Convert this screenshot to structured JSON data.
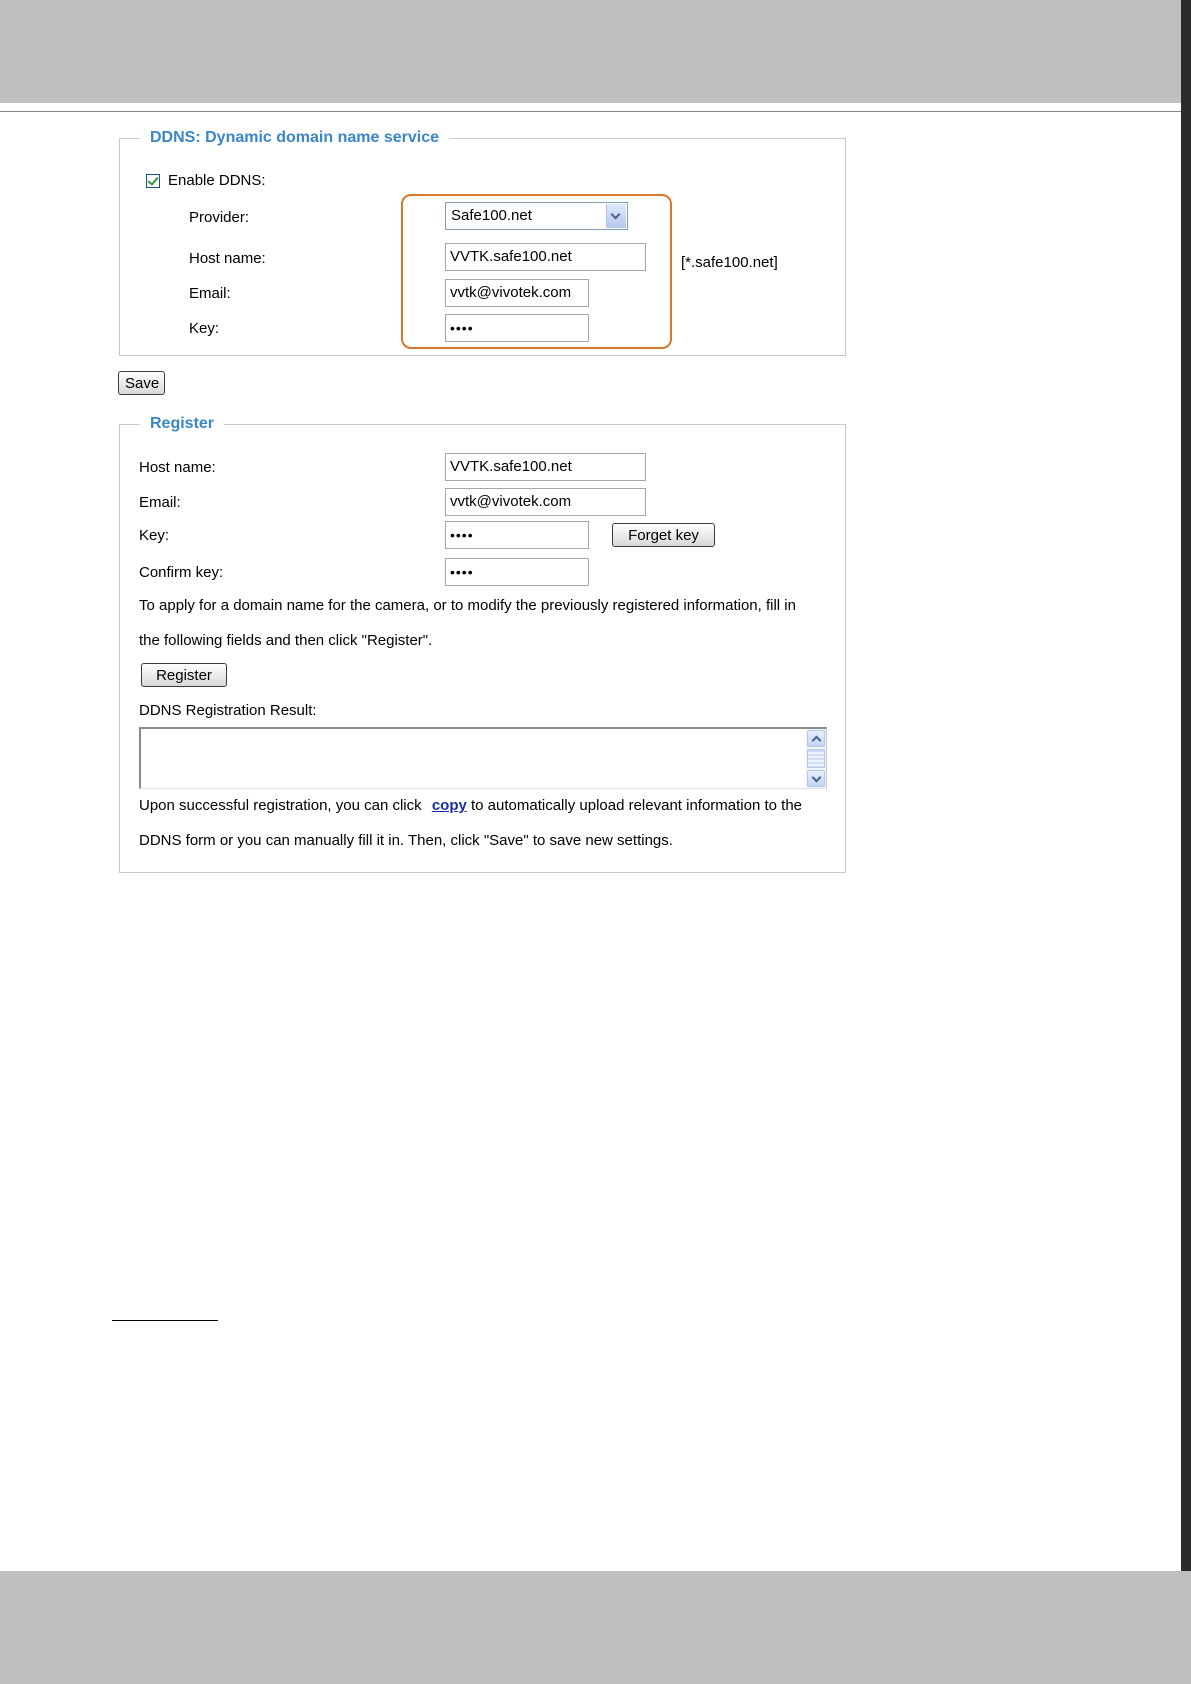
{
  "ddns": {
    "legend": "DDNS: Dynamic domain name service",
    "enable_label": "Enable DDNS:",
    "enabled": true,
    "provider_label": "Provider:",
    "provider_value": "Safe100.net",
    "hostname_label": "Host name:",
    "hostname_value": "VVTK.safe100.net",
    "hostname_suffix": "[*.safe100.net]",
    "email_label": "Email:",
    "email_value": "vvtk@vivotek.com",
    "key_label": "Key:",
    "key_value": "••••"
  },
  "save_button": "Save",
  "register": {
    "legend": "Register",
    "hostname_label": "Host name:",
    "hostname_value": "VVTK.safe100.net",
    "email_label": "Email:",
    "email_value": "vvtk@vivotek.com",
    "key_label": "Key:",
    "key_value": "••••",
    "forget_key_button": "Forget key",
    "confirm_key_label": "Confirm key:",
    "confirm_key_value": "••••",
    "instruction_line1": "To apply for a domain name for the camera, or to modify the previously registered information, fill in",
    "instruction_line2": "the following fields and then click \"Register\".",
    "register_button": "Register",
    "result_label": "DDNS Registration Result:",
    "result_value": "",
    "note_prefix": "Upon successful registration, you can click",
    "note_link": "copy",
    "note_suffix": "to automatically upload relevant information to the",
    "note_line2": "DDNS form or you can manually fill it in. Then, click \"Save\" to save new settings."
  },
  "icons": {
    "checkbox": "check-icon",
    "dropdown": "chevron-down-icon",
    "scroll_up": "chevron-up-icon",
    "scroll_down": "chevron-down-icon"
  },
  "colors": {
    "legend": "#3a86c8",
    "highlight": "#d9782b",
    "link": "#1a2ea0",
    "page_band": "#bfbfbf"
  }
}
